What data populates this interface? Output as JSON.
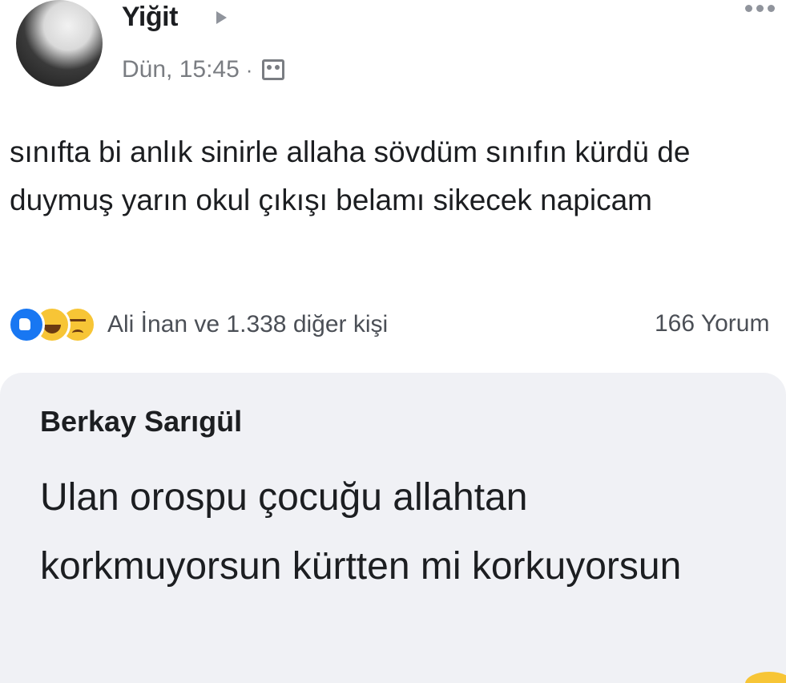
{
  "post": {
    "author": "Yiğit",
    "timestamp": "Dün, 15:45",
    "separator": "·",
    "privacy_icon": "friends-icon",
    "more_icon": "more-horizontal-icon",
    "text": "sınıfta bi anlık sinirle allaha sövdüm sınıfın kürdü de duymuş yarın okul çıkışı belamı sikecek napicam",
    "reactions": {
      "icons": [
        "like-icon",
        "haha-icon",
        "sad-icon"
      ],
      "summary": "Ali İnan ve 1.338 diğer kişi"
    },
    "comments_count": "166 Yorum"
  },
  "comment": {
    "author": "Berkay Sarıgül",
    "text": "Ulan orospu çocuğu allahtan korkmuyorsun kürtten mi korkuyorsun"
  },
  "colors": {
    "background": "#ffffff",
    "comment_bubble": "#f0f1f5",
    "like_blue": "#1877f2",
    "emoji_yellow": "#f7c536",
    "meta_gray": "#7a7d82"
  }
}
